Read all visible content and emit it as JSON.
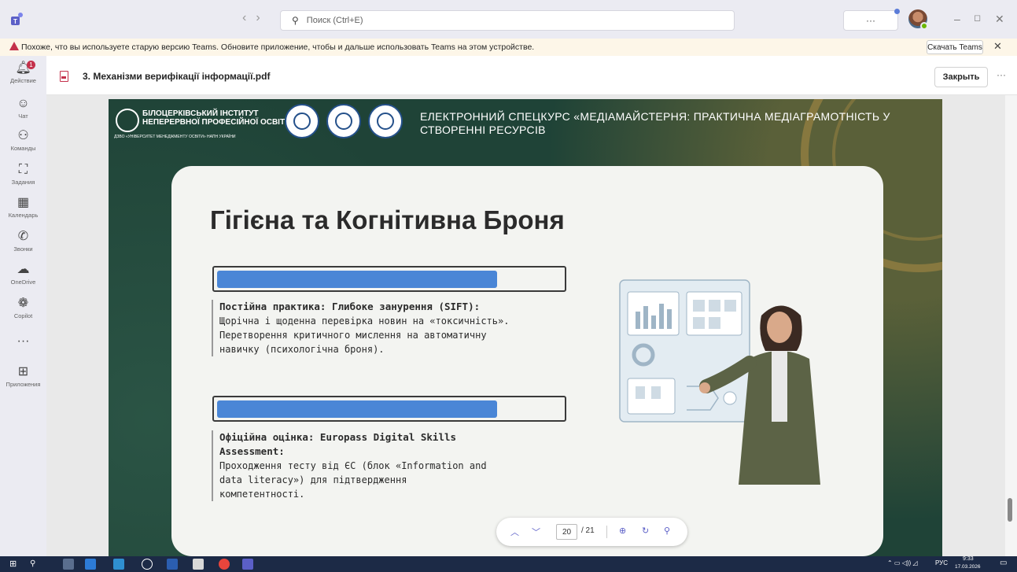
{
  "titlebar": {
    "search_placeholder": "Поиск (Ctrl+E)",
    "more_label": "···"
  },
  "banner": {
    "message": "Похоже, что вы используете старую версию Teams. Обновите приложение, чтобы и дальше использовать Teams на этом устройстве.",
    "download_label": "Скачать Teams",
    "close_label": "✕"
  },
  "rail": {
    "items": [
      {
        "label": "Действие",
        "icon": "bell-icon",
        "badge": "1"
      },
      {
        "label": "Чат",
        "icon": "chat-icon"
      },
      {
        "label": "Команды",
        "icon": "teams-icon"
      },
      {
        "label": "Задания",
        "icon": "assignments-icon"
      },
      {
        "label": "Календарь",
        "icon": "calendar-icon"
      },
      {
        "label": "Звонки",
        "icon": "phone-icon"
      },
      {
        "label": "OneDrive",
        "icon": "cloud-icon"
      },
      {
        "label": "Copilot",
        "icon": "copilot-icon"
      },
      {
        "label": "···",
        "icon": "more-icon"
      },
      {
        "label": "Приложения",
        "icon": "apps-icon"
      }
    ]
  },
  "document": {
    "title": "3. Механізми верифікації інформації.pdf",
    "close_label": "Закрыть",
    "more_label": "···"
  },
  "slide": {
    "institute_name_1": "БІЛОЦЕРКІВСЬКИЙ ІНСТИТУТ",
    "institute_name_2": "НЕПЕРЕРВНОЇ ПРОФЕСІЙНОЇ ОСВІТИ",
    "institute_sub": "ДЗВО «УНІВЕРСИТЕТ МЕНЕДЖМЕНТУ ОСВІТИ» НАПН УКРАЇНИ",
    "course_title": "ЕЛЕКТРОННИЙ СПЕЦКУРС «МЕДІАМАЙСТЕРНЯ: ПРАКТИЧНА МЕДІАГРАМОТНІСТЬ У СТВОРЕННІ РЕСУРСІВ",
    "heading": "Гігієна та Когнітивна Броня",
    "block1_heading": "Постійна практика: Глибоке занурення (SIFT):",
    "block1_line1": "Щорічна і щоденна перевірка новин на «токсичність».",
    "block1_line2": "Перетворення критичного мислення на автоматичну",
    "block1_line3": "навичку (психологічна броня).",
    "block2_heading_1": "Офіційна оцінка: Europass Digital Skills",
    "block2_heading_2": "Assessment:",
    "block2_line1": "Проходження тесту від ЄС (блок «Information and",
    "block2_line2": "data literacy») для підтвердження",
    "block2_line3": "компетентності."
  },
  "pdf_toolbar": {
    "current_page": "20",
    "total_pages": "/ 21"
  },
  "taskbar": {
    "time": "9:33",
    "date": "17.03.2026",
    "lang": "РУС"
  },
  "colors": {
    "accent": "#5b5fc7",
    "slide_bg": "#1f4337",
    "bar_blue": "#4a86d6",
    "warning_red": "#c4314b"
  }
}
